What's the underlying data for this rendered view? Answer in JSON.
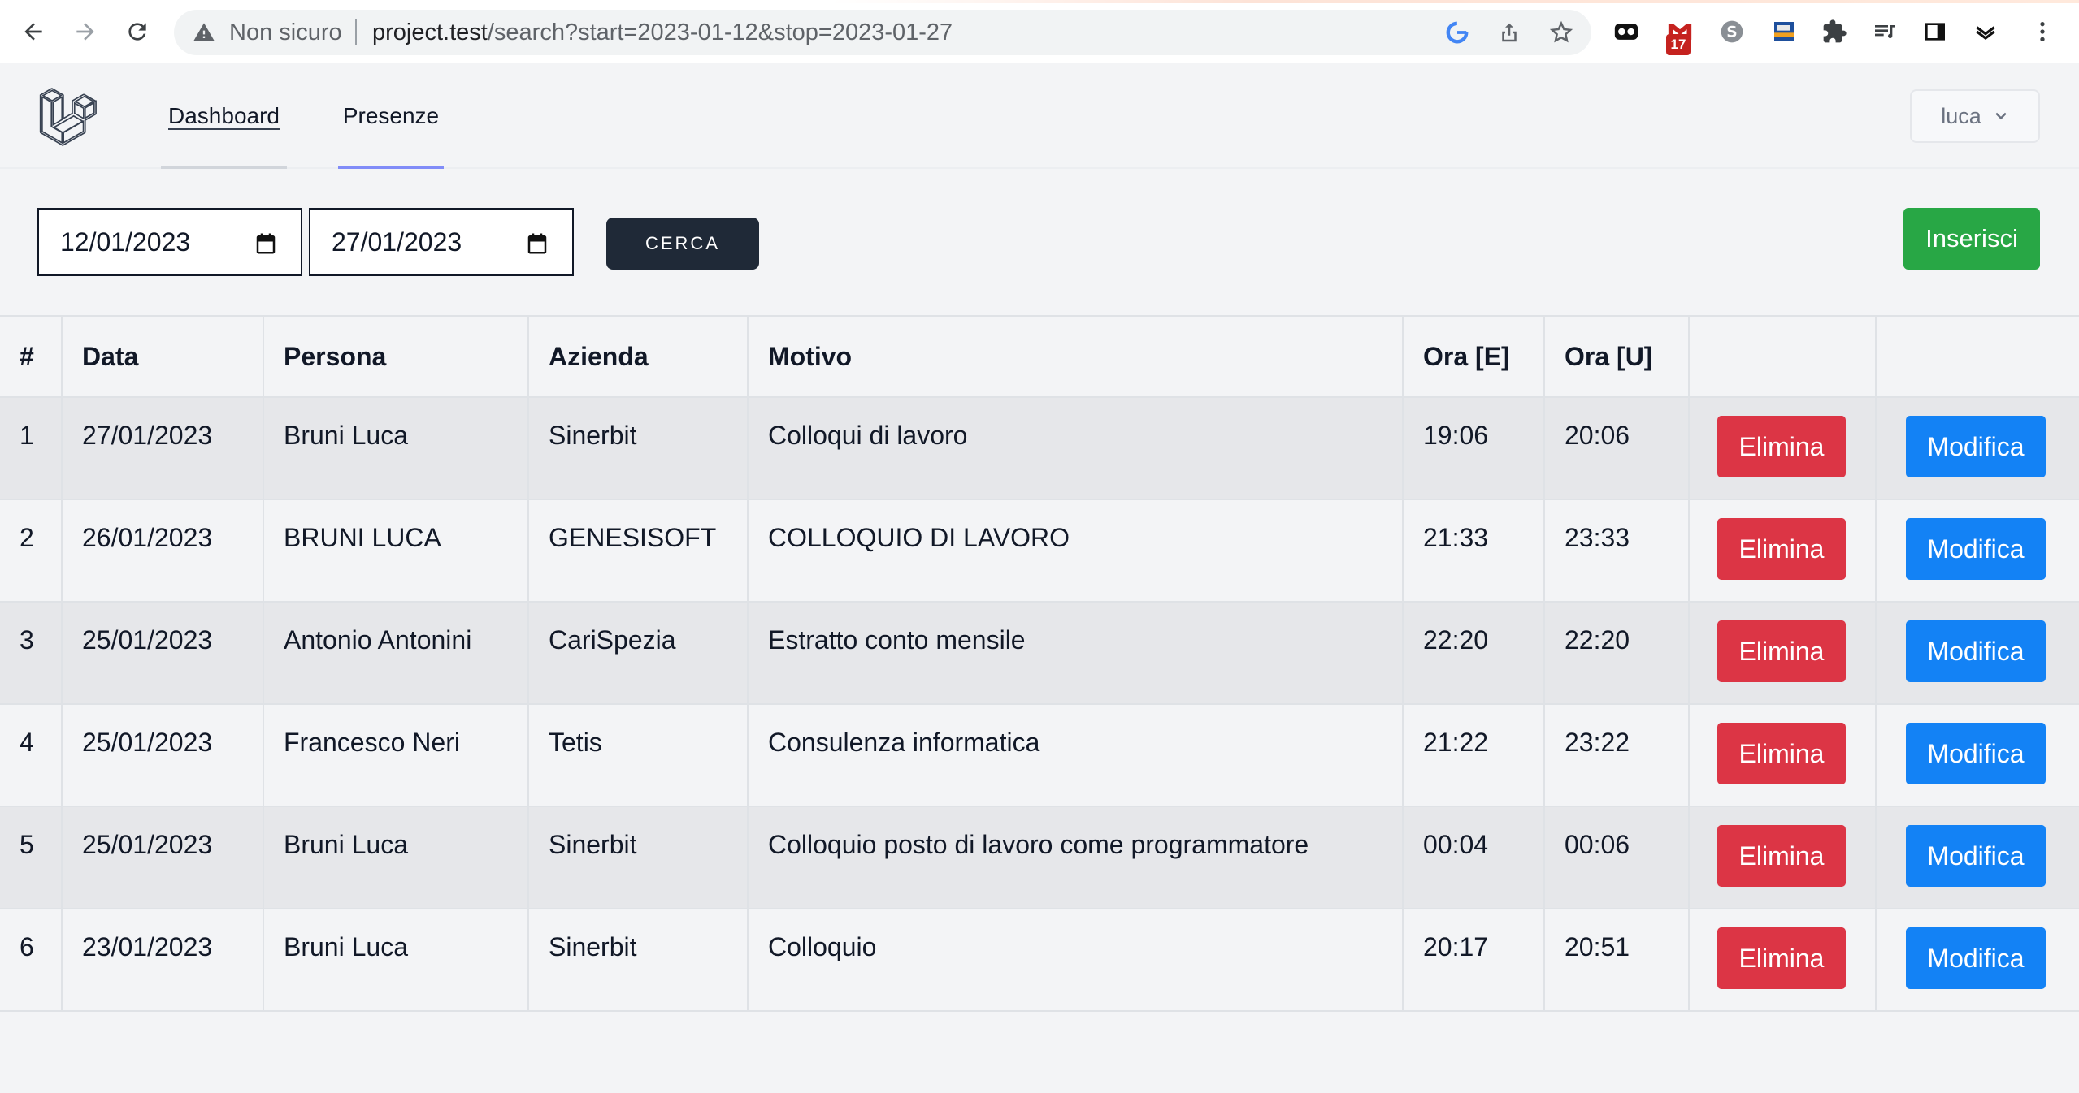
{
  "browser": {
    "security_label": "Non sicuro",
    "url_host": "project.test",
    "url_path": "/search?start=2023-01-12&stop=2023-01-27",
    "mail_badge": "17",
    "icons": [
      "back-arrow-icon",
      "forward-arrow-icon",
      "reload-icon",
      "warning-icon",
      "google-icon",
      "share-icon",
      "star-icon",
      "extension-icons",
      "menu-icon"
    ]
  },
  "nav": {
    "links": [
      {
        "label": "Dashboard"
      },
      {
        "label": "Presenze"
      }
    ],
    "user": "luca"
  },
  "search": {
    "start": "12/01/2023",
    "stop": "27/01/2023",
    "button": "CERCA"
  },
  "actions": {
    "insert": "Inserisci"
  },
  "table": {
    "headers": [
      "#",
      "Data",
      "Persona",
      "Azienda",
      "Motivo",
      "Ora [E]",
      "Ora [U]"
    ],
    "rows": [
      {
        "n": "1",
        "data": "27/01/2023",
        "persona": "Bruni Luca",
        "azienda": "Sinerbit",
        "motivo": "Colloqui di lavoro",
        "entrata": "19:06",
        "uscita": "20:06",
        "del": "Elimina",
        "mod": "Modifica"
      },
      {
        "n": "2",
        "data": "26/01/2023",
        "persona": "BRUNI LUCA",
        "azienda": "GENESISOFT",
        "motivo": "COLLOQUIO DI LAVORO",
        "entrata": "21:33",
        "uscita": "23:33",
        "del": "Elimina",
        "mod": "Modifica"
      },
      {
        "n": "3",
        "data": "25/01/2023",
        "persona": "Antonio Antonini",
        "azienda": "CariSpezia",
        "motivo": "Estratto conto mensile",
        "entrata": "22:20",
        "uscita": "22:20",
        "del": "Elimina",
        "mod": "Modifica"
      },
      {
        "n": "4",
        "data": "25/01/2023",
        "persona": "Francesco Neri",
        "azienda": "Tetis",
        "motivo": "Consulenza informatica",
        "entrata": "21:22",
        "uscita": "23:22",
        "del": "Elimina",
        "mod": "Modifica"
      },
      {
        "n": "5",
        "data": "25/01/2023",
        "persona": "Bruni Luca",
        "azienda": "Sinerbit",
        "motivo": "Colloquio posto di lavoro come programmatore",
        "entrata": "00:04",
        "uscita": "00:06",
        "del": "Elimina",
        "mod": "Modifica"
      },
      {
        "n": "6",
        "data": "23/01/2023",
        "persona": "Bruni Luca",
        "azienda": "Sinerbit",
        "motivo": "Colloquio",
        "entrata": "20:17",
        "uscita": "20:51",
        "del": "Elimina",
        "mod": "Modifica"
      }
    ]
  },
  "colors": {
    "danger": "#dc3545",
    "primary": "#1382f5",
    "success": "#28a745",
    "dark": "#1f2937",
    "nav_active": "#818cf8"
  }
}
